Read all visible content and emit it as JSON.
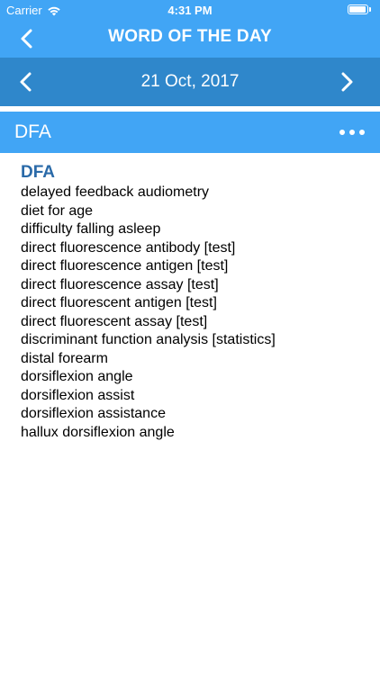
{
  "status_bar": {
    "carrier": "Carrier",
    "time": "4:31 PM",
    "icons": [
      "wifi-icon",
      "battery-icon"
    ]
  },
  "nav_bar": {
    "title": "WORD OF THE DAY",
    "back_icon": "chevron-left-icon"
  },
  "date_bar": {
    "date": "21 Oct, 2017",
    "prev_icon": "chevron-left-icon",
    "next_icon": "chevron-right-icon"
  },
  "word_bar": {
    "word": "DFA",
    "more_icon": "more-horizontal-icon"
  },
  "content": {
    "heading": "DFA",
    "definitions": [
      "delayed feedback audiometry",
      "diet for age",
      "difficulty falling asleep",
      "direct fluorescence antibody [test]",
      "direct fluorescence antigen [test]",
      "direct fluorescence assay [test]",
      "direct fluorescent antigen [test]",
      "direct fluorescent assay [test]",
      "discriminant function analysis [statistics]",
      "distal forearm",
      "dorsiflexion angle",
      "dorsiflexion assist",
      "dorsiflexion assistance",
      "hallux dorsiflexion angle"
    ]
  },
  "colors": {
    "nav_blue": "#41a5f5",
    "date_blue": "#2f87cb",
    "heading_blue": "#2a6aa8",
    "text": "#000000",
    "background": "#ffffff"
  }
}
